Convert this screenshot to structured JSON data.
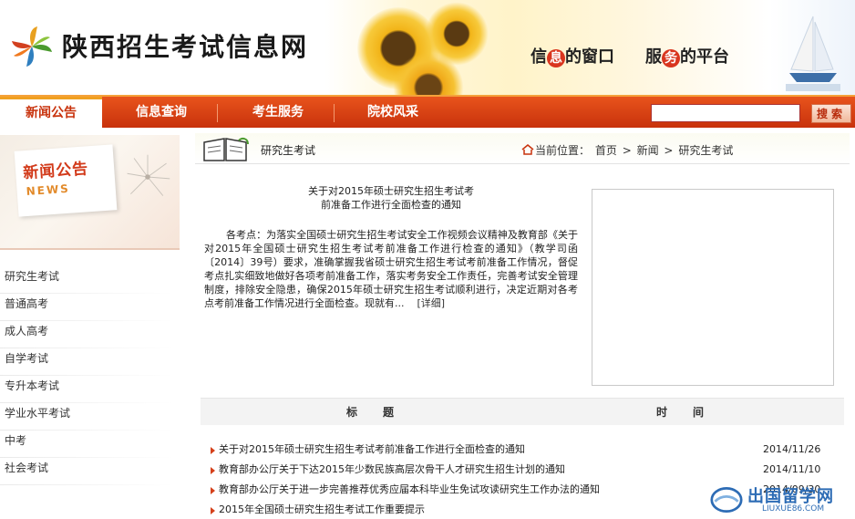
{
  "header": {
    "site_title": "陕西招生考试信息网",
    "slogan_left_a": "信",
    "slogan_left_hl": "息",
    "slogan_left_b": "的窗口",
    "slogan_right_a": "服",
    "slogan_right_hl": "务",
    "slogan_right_b": "的平台"
  },
  "nav": {
    "items": [
      {
        "label": "新闻公告",
        "active": true
      },
      {
        "label": "信息查询"
      },
      {
        "label": "考生服务"
      },
      {
        "label": "院校风采"
      }
    ],
    "search_value": "",
    "search_button": "搜索"
  },
  "sidebar": {
    "banner_cn": "新闻公告",
    "banner_en": "NEWS",
    "items": [
      {
        "label": "研究生考试"
      },
      {
        "label": "普通高考"
      },
      {
        "label": "成人高考"
      },
      {
        "label": "自学考试"
      },
      {
        "label": "专升本考试"
      },
      {
        "label": "学业水平考试"
      },
      {
        "label": "中考"
      },
      {
        "label": "社会考试"
      }
    ]
  },
  "crumb": {
    "section": "研究生考试",
    "location_label": "当前位置：",
    "path_home": "首页",
    "sep": ">",
    "path_news": "新闻",
    "path_current": "研究生考试"
  },
  "article": {
    "title_line1": "关于对2015年硕士研究生招生考试考",
    "title_line2": "前准备工作进行全面检查的通知",
    "body": "各考点：为落实全国硕士研究生招生考试安全工作视频会议精神及教育部《关于对2015年全国硕士研究生招生考试考前准备工作进行检查的通知》（教学司函〔2014〕39号）要求，准确掌握我省硕士研究生招生考试考前准备工作情况，督促考点扎实细致地做好各项考前准备工作，落实考务安全工作责任，完善考试安全管理制度，排除安全隐患，确保2015年硕士研究生招生考试顺利进行，决定近期对各考点考前准备工作情况进行全面检查。现就有...",
    "more": "[详细]"
  },
  "table": {
    "header_title": "标题",
    "header_time": "时间",
    "rows": [
      {
        "title": "关于对2015年硕士研究生招生考试考前准备工作进行全面检查的通知",
        "date": "2014/11/26"
      },
      {
        "title": "教育部办公厅关于下达2015年少数民族高层次骨干人才研究生招生计划的通知",
        "date": "2014/11/10"
      },
      {
        "title": "教育部办公厅关于进一步完善推荐优秀应届本科毕业生免试攻读研究生工作办法的通知",
        "date": "2014/09/30"
      },
      {
        "title": "2015年全国硕士研究生招生考试工作重要提示",
        "date": ""
      }
    ]
  },
  "watermark": {
    "text": "出国留学网",
    "url": "LIUXUE86.COM"
  },
  "colors": {
    "nav_red": "#c8320c",
    "accent_orange": "#f0a020",
    "bullet": "#d5401a"
  }
}
